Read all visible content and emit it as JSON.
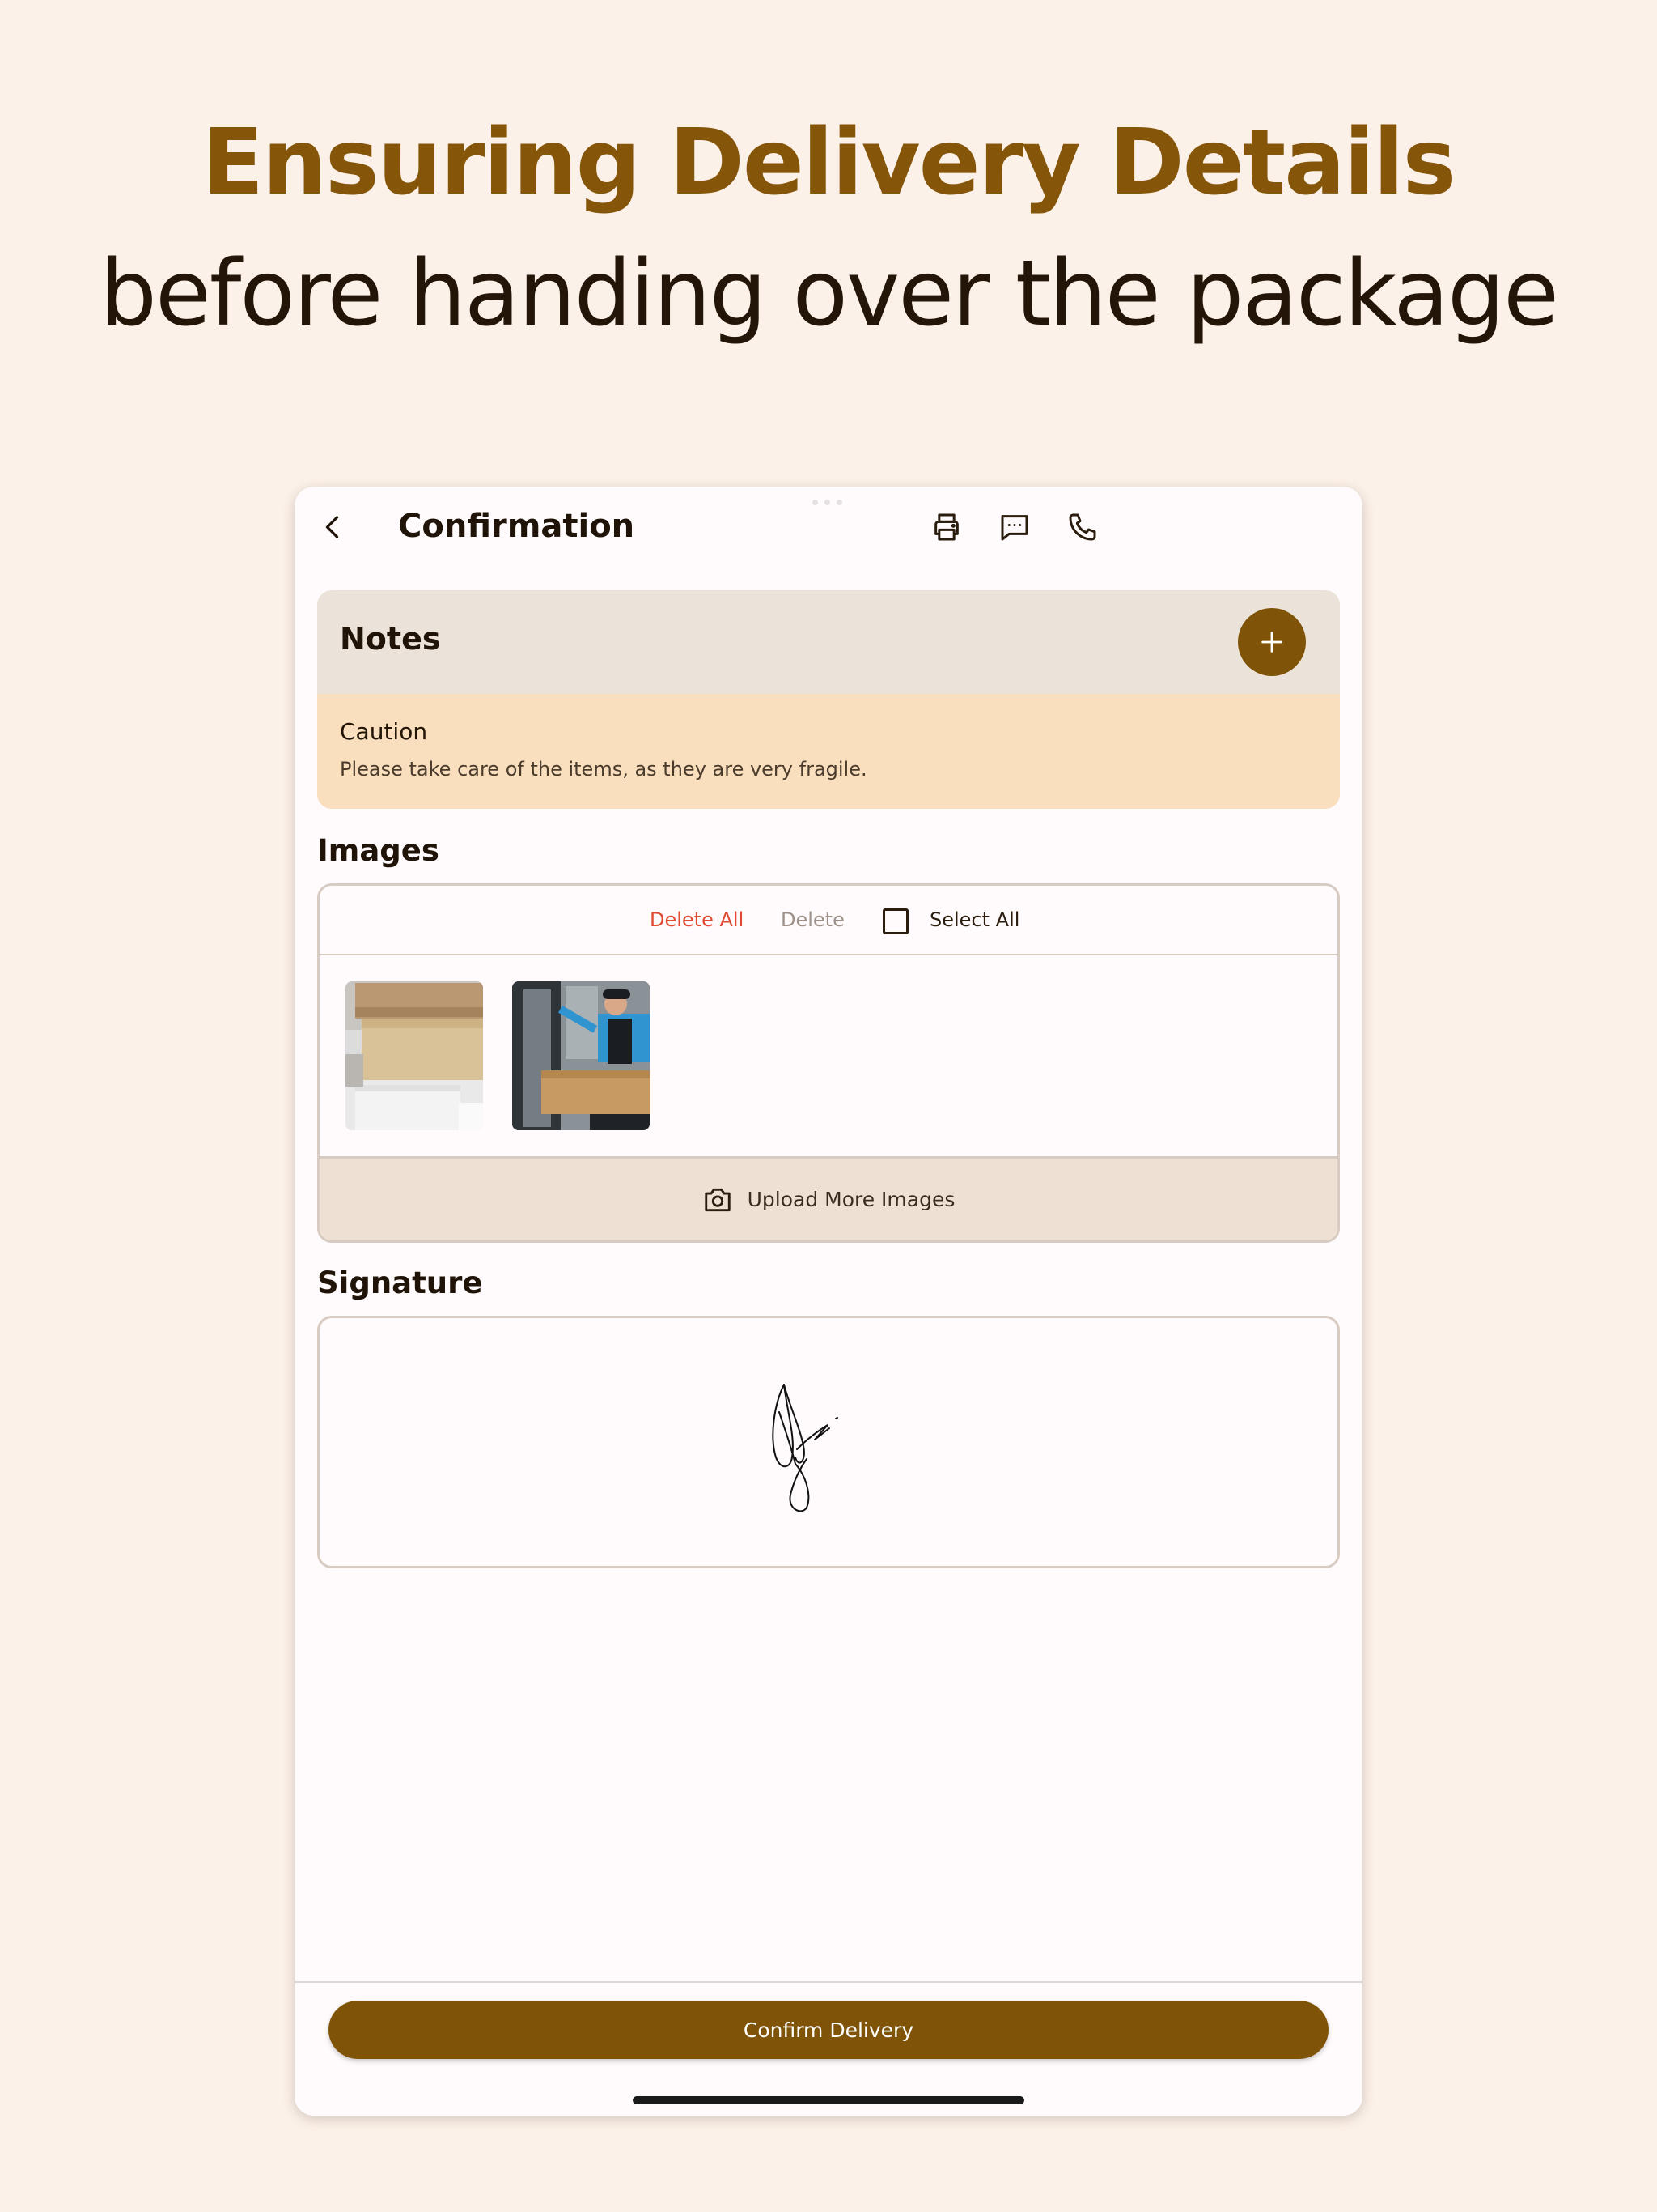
{
  "headline": {
    "title": "Ensuring Delivery Details",
    "subtitle": "before handing over the package"
  },
  "appbar": {
    "title": "Confirmation",
    "actions": [
      "printer-icon",
      "message-icon",
      "phone-icon"
    ]
  },
  "notes": {
    "title": "Notes",
    "add_icon": "plus-icon",
    "items": [
      {
        "title": "Caution",
        "text": "Please take care of the items, as they are very fragile."
      }
    ]
  },
  "images": {
    "section_label": "Images",
    "toolbar": {
      "delete_all": "Delete All",
      "delete": "Delete",
      "select_all": "Select All",
      "select_all_checked": false
    },
    "thumbnails": [
      "stacked-boxes-photo",
      "courier-at-door-photo"
    ],
    "upload_label": "Upload More Images",
    "upload_icon": "camera-icon"
  },
  "signature": {
    "section_label": "Signature"
  },
  "footer": {
    "confirm_label": "Confirm Delivery"
  },
  "colors": {
    "page_background": "#fcf1e8",
    "brand": "#805408",
    "headline_accent": "#85560a",
    "notes_header": "#ebe2d9",
    "caution_background": "#f9dfbd",
    "destructive": "#e04a33"
  }
}
